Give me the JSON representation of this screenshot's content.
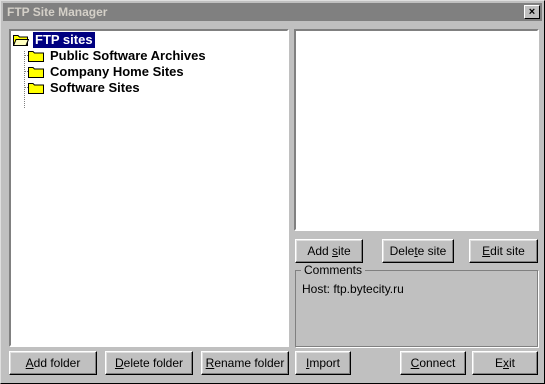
{
  "window": {
    "title": "FTP Site Manager",
    "close_label": "×"
  },
  "tree": {
    "root": "FTP sites",
    "items": [
      {
        "label": "Public Software Archives"
      },
      {
        "label": "Company Home Sites"
      },
      {
        "label": "Software Sites"
      }
    ]
  },
  "site_buttons": {
    "add": {
      "pre": "Add ",
      "acc": "s",
      "post": "ite"
    },
    "delete": {
      "pre": "Dele",
      "acc": "t",
      "post": "e site"
    },
    "edit": {
      "pre": "",
      "acc": "E",
      "post": "dit site"
    }
  },
  "comments": {
    "legend": "Comments",
    "text": "Host: ftp.bytecity.ru"
  },
  "bottom_buttons": {
    "add_folder": {
      "pre": "",
      "acc": "A",
      "post": "dd folder"
    },
    "delete_folder": {
      "pre": "",
      "acc": "D",
      "post": "elete folder"
    },
    "rename_folder": {
      "pre": "",
      "acc": "R",
      "post": "ename folder"
    },
    "import": {
      "pre": "",
      "acc": "I",
      "post": "mport"
    },
    "connect": {
      "pre": "",
      "acc": "C",
      "post": "onnect"
    },
    "exit": {
      "pre": "E",
      "acc": "x",
      "post": "it"
    }
  }
}
